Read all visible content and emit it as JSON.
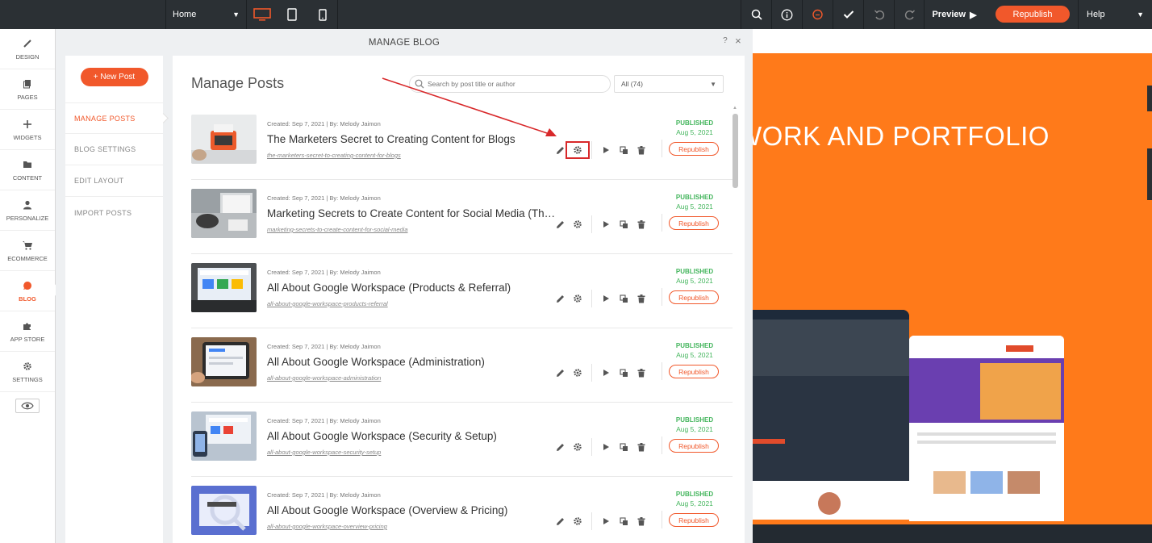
{
  "topbar": {
    "page_select": "Home",
    "preview_label": "Preview",
    "republish_label": "Republish",
    "help_label": "Help"
  },
  "rail": {
    "items": [
      {
        "label": "DESIGN",
        "icon": "brush-icon"
      },
      {
        "label": "PAGES",
        "icon": "pages-icon"
      },
      {
        "label": "WIDGETS",
        "icon": "plus-icon"
      },
      {
        "label": "CONTENT",
        "icon": "folder-icon"
      },
      {
        "label": "PERSONALIZE",
        "icon": "person-icon"
      },
      {
        "label": "ECOMMERCE",
        "icon": "cart-icon"
      },
      {
        "label": "BLOG",
        "icon": "blog-icon"
      },
      {
        "label": "APP STORE",
        "icon": "puzzle-icon"
      },
      {
        "label": "SETTINGS",
        "icon": "gear-icon"
      }
    ]
  },
  "modal": {
    "title": "MANAGE BLOG",
    "help": "?",
    "close": "×",
    "new_post_label": "+ New Post",
    "subnav": [
      "MANAGE POSTS",
      "BLOG SETTINGS",
      "EDIT LAYOUT",
      "IMPORT POSTS"
    ],
    "content_title": "Manage Posts",
    "search_placeholder": "Search by post title or author",
    "filter_value": "All (74)"
  },
  "posts": [
    {
      "meta": "Created: Sep 7, 2021 | By: Melody Jaimon",
      "title": "The Marketers Secret to Creating Content for Blogs",
      "slug": "the-marketers-secret-to-creating-content-for-blogs",
      "status": "PUBLISHED",
      "date": "Aug 5, 2021",
      "republish": "Republish"
    },
    {
      "meta": "Created: Sep 7, 2021 | By: Melody Jaimon",
      "title": "Marketing Secrets to Create Content for Social Media (The Complete Guide)",
      "slug": "marketing-secrets-to-create-content-for-social-media",
      "status": "PUBLISHED",
      "date": "Aug 5, 2021",
      "republish": "Republish"
    },
    {
      "meta": "Created: Sep 7, 2021 | By: Melody Jaimon",
      "title": "All About Google Workspace (Products & Referral)",
      "slug": "all-about-google-workspace-products-referral",
      "status": "PUBLISHED",
      "date": "Aug 5, 2021",
      "republish": "Republish"
    },
    {
      "meta": "Created: Sep 7, 2021 | By: Melody Jaimon",
      "title": "All About Google Workspace (Administration)",
      "slug": "all-about-google-workspace-administration",
      "status": "PUBLISHED",
      "date": "Aug 5, 2021",
      "republish": "Republish"
    },
    {
      "meta": "Created: Sep 7, 2021 | By: Melody Jaimon",
      "title": "All About Google Workspace (Security & Setup)",
      "slug": "all-about-google-workspace-security-setup",
      "status": "PUBLISHED",
      "date": "Aug 5, 2021",
      "republish": "Republish"
    },
    {
      "meta": "Created: Sep 7, 2021 | By: Melody Jaimon",
      "title": "All About Google Workspace (Overview & Pricing)",
      "slug": "all-about-google-workspace-overview-pricing",
      "status": "PUBLISHED",
      "date": "Aug 5, 2021",
      "republish": "Republish"
    }
  ],
  "preview": {
    "heading": "WORK AND PORTFOLIO"
  },
  "colors": {
    "accent": "#f1582b",
    "published": "#43b55c",
    "highlight": "#d8282a",
    "preview_bg": "#ff7a1a"
  }
}
